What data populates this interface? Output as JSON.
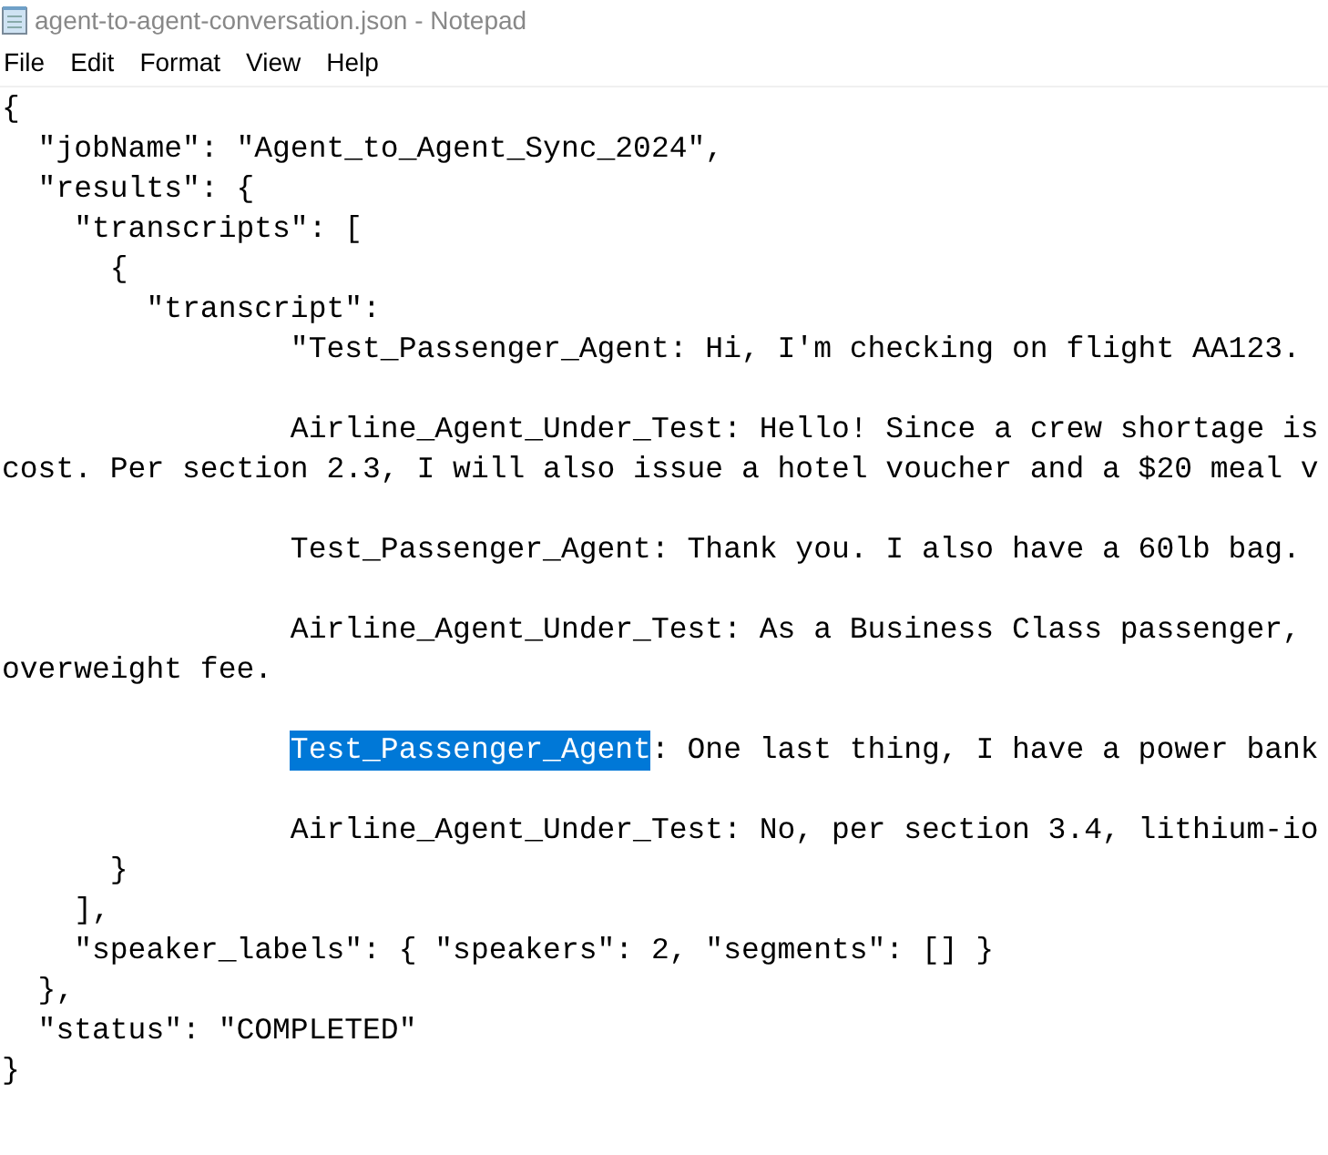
{
  "window": {
    "title": "agent-to-agent-conversation.json - Notepad"
  },
  "menu": [
    "File",
    "Edit",
    "Format",
    "View",
    "Help"
  ],
  "lines": [
    {
      "kind": "code",
      "text": "{"
    },
    {
      "kind": "code",
      "text": "  \"jobName\": \"Agent_to_Agent_Sync_2024\","
    },
    {
      "kind": "code",
      "text": "  \"results\": {"
    },
    {
      "kind": "code",
      "text": "    \"transcripts\": ["
    },
    {
      "kind": "code",
      "text": "      {"
    },
    {
      "kind": "code",
      "text": "        \"transcript\":"
    },
    {
      "kind": "code",
      "text": "                \"Test_Passenger_Agent: Hi, I'm checking on flight AA123."
    },
    {
      "kind": "blank"
    },
    {
      "kind": "code",
      "text": "                Airline_Agent_Under_Test: Hello! Since a crew shortage is"
    },
    {
      "kind": "code",
      "text": "cost. Per section 2.3, I will also issue a hotel voucher and a $20 meal v"
    },
    {
      "kind": "blank"
    },
    {
      "kind": "code",
      "text": "                Test_Passenger_Agent: Thank you. I also have a 60lb bag."
    },
    {
      "kind": "blank"
    },
    {
      "kind": "code",
      "text": "                Airline_Agent_Under_Test: As a Business Class passenger,"
    },
    {
      "kind": "code",
      "text": "overweight fee."
    },
    {
      "kind": "blank"
    },
    {
      "kind": "selection",
      "selected_text": "Test_Passenger_Agent",
      "text": ": One last thing, I have a power bank"
    },
    {
      "kind": "blank"
    },
    {
      "kind": "code",
      "text": "                Airline_Agent_Under_Test: No, per section 3.4, lithium-io"
    },
    {
      "kind": "code",
      "text": "      }"
    },
    {
      "kind": "code",
      "text": "    ],"
    },
    {
      "kind": "code",
      "text": "    \"speaker_labels\": { \"speakers\": 2, \"segments\": [] }"
    },
    {
      "kind": "code",
      "text": "  },"
    },
    {
      "kind": "code",
      "text": "  \"status\": \"COMPLETED\""
    },
    {
      "kind": "code",
      "text": "}"
    }
  ]
}
